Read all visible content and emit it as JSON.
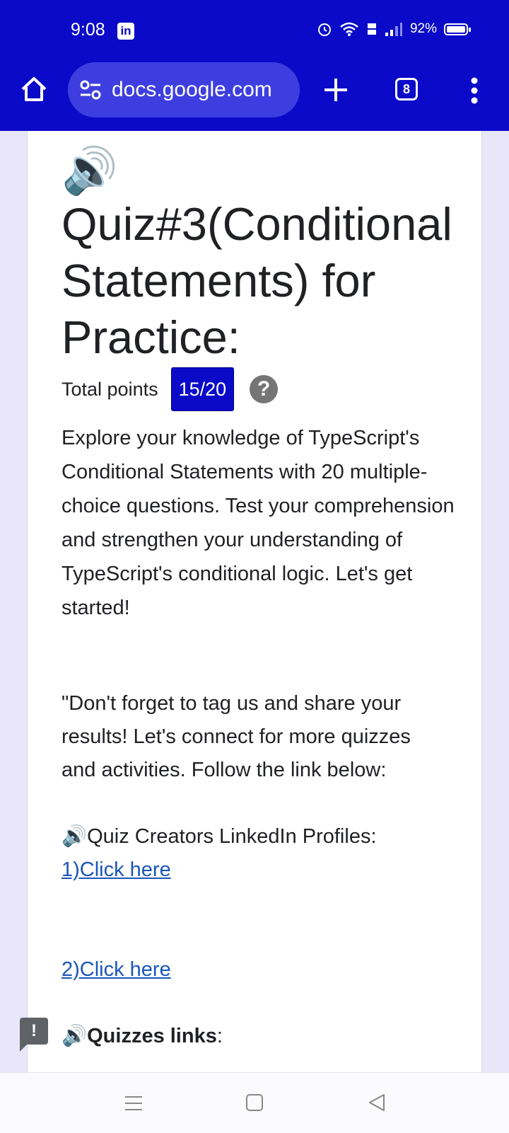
{
  "status_bar": {
    "time": "9:08",
    "app_badge": "in",
    "battery": "92%"
  },
  "toolbar": {
    "url": "docs.google.com",
    "tab_count": "8"
  },
  "form": {
    "title": "Quiz#3(Conditional Statements) for Practice:",
    "total_points_label": "Total points",
    "score": "15/20",
    "help_symbol": "?",
    "description": "Explore your knowledge of TypeScript's Conditional Statements with 20 multiple-choice questions. Test your comprehension and strengthen your understanding of TypeScript's conditional logic. Let's get started!",
    "share_line_1": "\"Don't forget to tag us and share your",
    "share_line_2": "results! Let's connect for more quizzes",
    "share_line_3": "and activities. Follow the link below:",
    "creators_heading": "Quiz Creators LinkedIn Profiles:",
    "link_1": "1)Click here",
    "link_2": "2)Click here",
    "quizzes_heading": "Quizzes links",
    "quizzes_colon": ":"
  },
  "feedback_symbol": "!",
  "icons": [
    "home-icon",
    "site-settings-icon",
    "plus-icon",
    "tabs-icon",
    "more-vert-icon",
    "speaker-icon",
    "help-icon",
    "feedback-icon",
    "nav-menu-icon",
    "nav-home-icon",
    "nav-back-icon"
  ],
  "colors": {
    "chrome": "#0a0ac8",
    "badge": "#0a0ac8",
    "link": "#1a56b8"
  }
}
